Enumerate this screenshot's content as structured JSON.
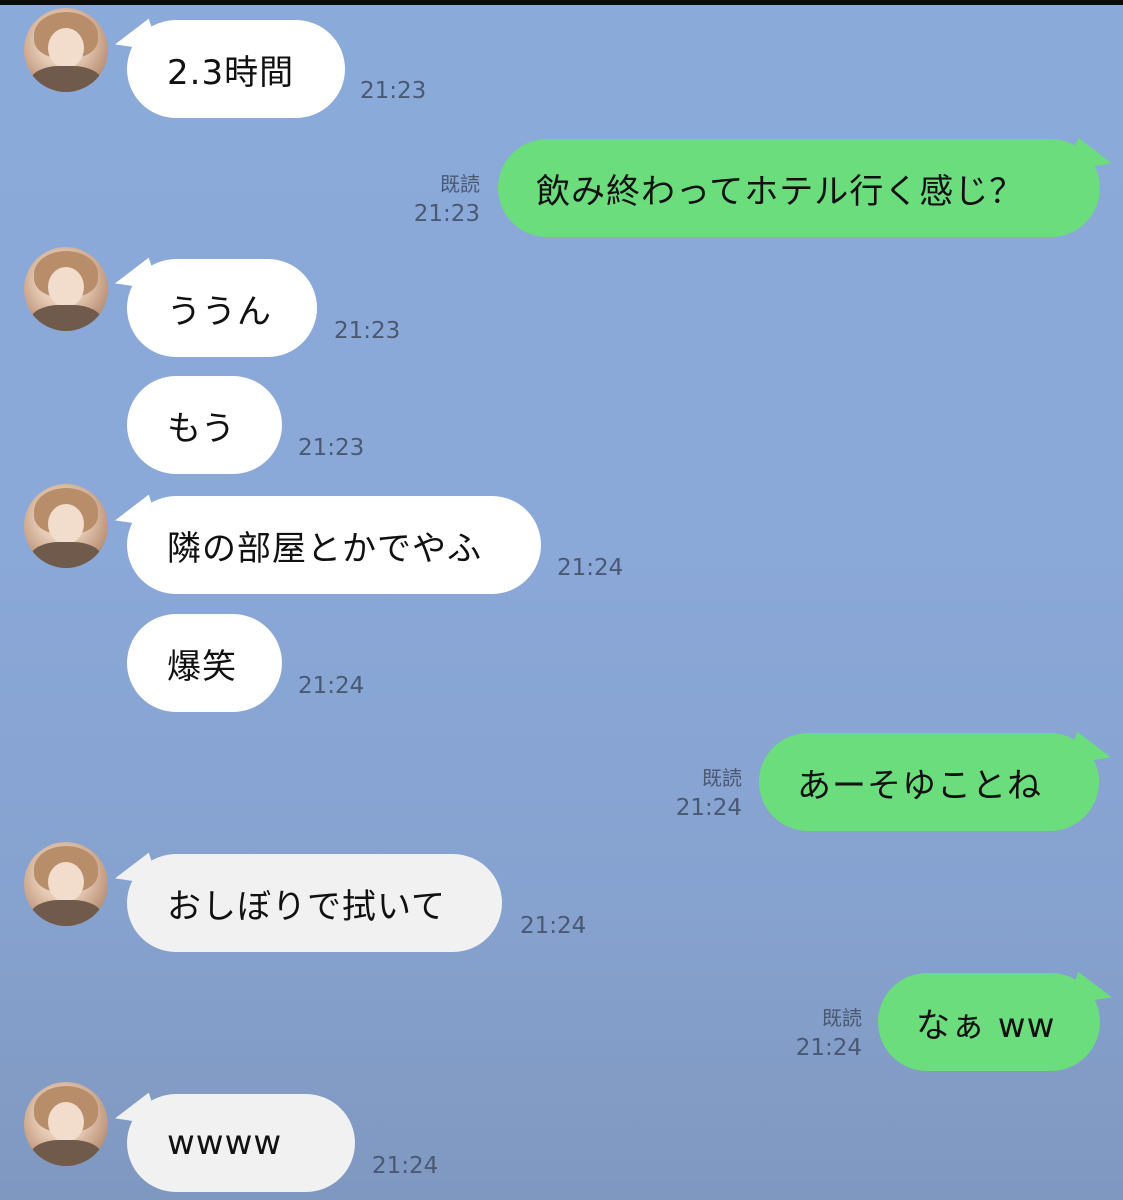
{
  "messages": [
    {
      "from": "other",
      "text": "2.3時間",
      "time": "21:23"
    },
    {
      "from": "me",
      "text": "飲み終わってホテル行く感じ？",
      "read": "既読",
      "time": "21:23"
    },
    {
      "from": "other",
      "text": "ううん",
      "time": "21:23"
    },
    {
      "from": "other",
      "text": "もう",
      "time": "21:23"
    },
    {
      "from": "other",
      "text": "隣の部屋とかでやふ",
      "time": "21:24"
    },
    {
      "from": "other",
      "text": "爆笑",
      "time": "21:24"
    },
    {
      "from": "me",
      "text": "あーそゆことね",
      "read": "既読",
      "time": "21:24"
    },
    {
      "from": "other",
      "text": "おしぼりで拭いて",
      "time": "21:24"
    },
    {
      "from": "me",
      "text": "なぁ ww",
      "read": "既読",
      "time": "21:24"
    },
    {
      "from": "other",
      "text": "wwww",
      "time": "21:24"
    }
  ],
  "colors": {
    "background": "#8aaad9",
    "incoming_bubble": "#ffffff",
    "outgoing_bubble": "#6bdd7d",
    "meta_text": "#4a5872"
  }
}
